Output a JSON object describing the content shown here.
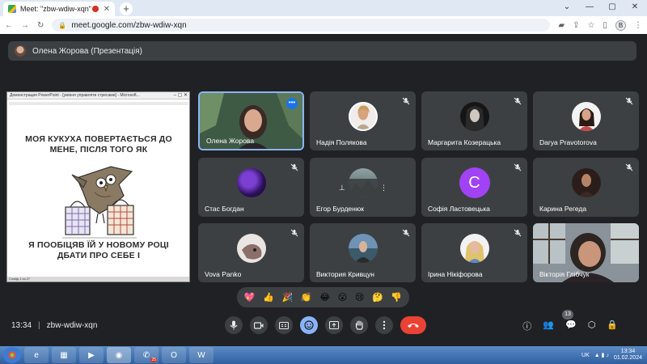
{
  "browser": {
    "tab_title": "Meet: \"zbw-wdiw-xqn\"",
    "url": "meet.google.com/zbw-wdiw-xqn",
    "profile_letter": "B"
  },
  "presenter": {
    "label": "Олена Жорова (Презентація)"
  },
  "shared_window": {
    "title": "Демонстрация PowerPoint - [уміння управляти стресами] - Microsoft...",
    "slide_text_top": "МОЯ КУКУХА ПОВЕРТАЄТЬСЯ ДО МЕНЕ, ПІСЛЯ ТОГО ЯК",
    "slide_text_bottom": "Я ПООБІЦЯВ ЇЙ У НОВОМУ РОЦІ ДБАТИ ПРО СЕБЕ І",
    "status": "Слайд 1 из 27"
  },
  "participants": [
    {
      "name": "Олена Жорова"
    },
    {
      "name": "Надія Полякова"
    },
    {
      "name": "Маргарита Козерацька"
    },
    {
      "name": "Darya Pravotorova"
    },
    {
      "name": "Стас Богдан"
    },
    {
      "name": "Егор Бурденюк"
    },
    {
      "name": "Софія Ластовецька",
      "initial": "C"
    },
    {
      "name": "Карина Регеда"
    },
    {
      "name": "Vova Panko"
    },
    {
      "name": "Виктория Кривцун"
    },
    {
      "name": "Ірина Нікіфорова"
    },
    {
      "name": "Вікторія Глібчук"
    }
  ],
  "reactions": [
    "💖",
    "👍",
    "🎉",
    "👏",
    "😂",
    "😮",
    "😢",
    "🤔",
    "👎"
  ],
  "bottom": {
    "time": "13:34",
    "sep": "|",
    "meeting_code": "zbw-wdiw-xqn",
    "participant_count": "13"
  },
  "taskbar": {
    "lang": "UK",
    "time": "13:34",
    "date": "01.02.2024",
    "viber_badge": "25"
  },
  "colors": {
    "background": "#202124",
    "tile": "#3c4043",
    "accent": "#8ab4f8",
    "end_call": "#ea4335",
    "avatar_purple": "#a142f4"
  }
}
